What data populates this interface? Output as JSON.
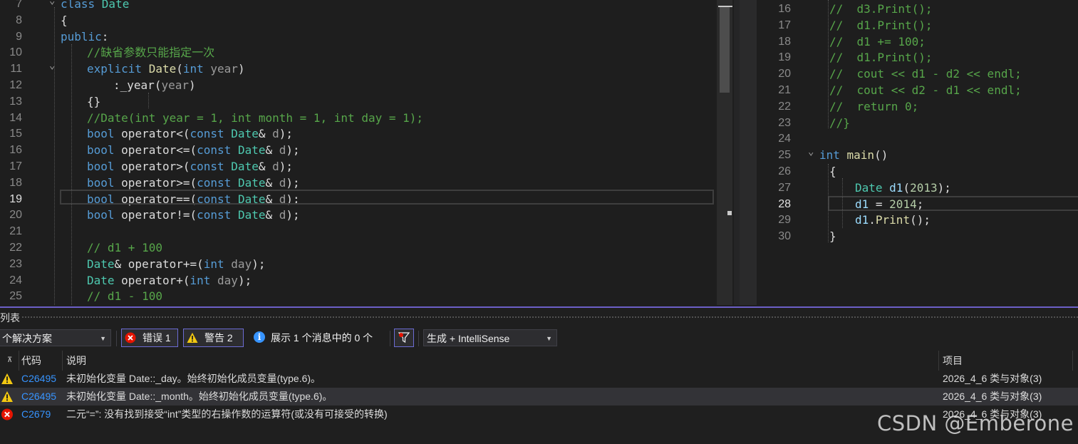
{
  "left_editor": {
    "lines": [
      {
        "n": "7",
        "fold": "⌄",
        "indent": 0,
        "tokens": [
          [
            "kw",
            "class "
          ],
          [
            "ty",
            "Date"
          ]
        ]
      },
      {
        "n": "8",
        "indent": 0,
        "tokens": [
          [
            "txt",
            "{"
          ]
        ]
      },
      {
        "n": "9",
        "indent": 0,
        "tokens": [
          [
            "kw",
            "public"
          ],
          [
            "txt",
            ":"
          ]
        ]
      },
      {
        "n": "10",
        "indent": 1,
        "tokens": [
          [
            "cm",
            "//缺省参数只能指定一次"
          ]
        ]
      },
      {
        "n": "11",
        "fold": "⌄",
        "indent": 1,
        "tokens": [
          [
            "kw",
            "explicit "
          ],
          [
            "fn",
            "Date"
          ],
          [
            "txt",
            "("
          ],
          [
            "kw",
            "int "
          ],
          [
            "dim",
            "year"
          ],
          [
            "txt",
            ")"
          ]
        ]
      },
      {
        "n": "12",
        "indent": 2,
        "tokens": [
          [
            "txt",
            ":"
          ],
          [
            "txt",
            "_year"
          ],
          [
            "txt",
            "("
          ],
          [
            "dim",
            "year"
          ],
          [
            "txt",
            ")"
          ]
        ]
      },
      {
        "n": "13",
        "indent": 1,
        "tokens": [
          [
            "txt",
            "{}"
          ]
        ]
      },
      {
        "n": "14",
        "indent": 1,
        "tokens": [
          [
            "cm",
            "//Date(int year = 1, int month = 1, int day = 1);"
          ]
        ]
      },
      {
        "n": "15",
        "indent": 1,
        "tokens": [
          [
            "kw",
            "bool "
          ],
          [
            "txt",
            "operator<("
          ],
          [
            "kw",
            "const "
          ],
          [
            "ty",
            "Date"
          ],
          [
            "txt",
            "& "
          ],
          [
            "dim",
            "d"
          ],
          [
            "txt",
            ");"
          ]
        ]
      },
      {
        "n": "16",
        "indent": 1,
        "tokens": [
          [
            "kw",
            "bool "
          ],
          [
            "txt",
            "operator<=("
          ],
          [
            "kw",
            "const "
          ],
          [
            "ty",
            "Date"
          ],
          [
            "txt",
            "& "
          ],
          [
            "dim",
            "d"
          ],
          [
            "txt",
            ");"
          ]
        ]
      },
      {
        "n": "17",
        "indent": 1,
        "tokens": [
          [
            "kw",
            "bool "
          ],
          [
            "txt",
            "operator>("
          ],
          [
            "kw",
            "const "
          ],
          [
            "ty",
            "Date"
          ],
          [
            "txt",
            "& "
          ],
          [
            "dim",
            "d"
          ],
          [
            "txt",
            ");"
          ]
        ]
      },
      {
        "n": "18",
        "indent": 1,
        "tokens": [
          [
            "kw",
            "bool "
          ],
          [
            "txt",
            "operator>=("
          ],
          [
            "kw",
            "const "
          ],
          [
            "ty",
            "Date"
          ],
          [
            "txt",
            "& "
          ],
          [
            "dim",
            "d"
          ],
          [
            "txt",
            ");"
          ]
        ]
      },
      {
        "n": "19",
        "active": true,
        "indent": 1,
        "tokens": [
          [
            "kw",
            "bool "
          ],
          [
            "txt",
            "operator==("
          ],
          [
            "kw",
            "const "
          ],
          [
            "ty",
            "Date"
          ],
          [
            "txt",
            "& "
          ],
          [
            "dim",
            "d"
          ],
          [
            "txt",
            ");"
          ]
        ]
      },
      {
        "n": "20",
        "indent": 1,
        "tokens": [
          [
            "kw",
            "bool "
          ],
          [
            "txt",
            "operator!=("
          ],
          [
            "kw",
            "const "
          ],
          [
            "ty",
            "Date"
          ],
          [
            "txt",
            "& "
          ],
          [
            "dim",
            "d"
          ],
          [
            "txt",
            ");"
          ]
        ]
      },
      {
        "n": "21",
        "indent": 1,
        "tokens": []
      },
      {
        "n": "22",
        "indent": 1,
        "tokens": [
          [
            "cm",
            "// d1 + 100"
          ]
        ]
      },
      {
        "n": "23",
        "indent": 1,
        "tokens": [
          [
            "ty",
            "Date"
          ],
          [
            "txt",
            "& operator+=("
          ],
          [
            "kw",
            "int "
          ],
          [
            "dim",
            "day"
          ],
          [
            "txt",
            ");"
          ]
        ]
      },
      {
        "n": "24",
        "indent": 1,
        "tokens": [
          [
            "ty",
            "Date "
          ],
          [
            "txt",
            "operator+("
          ],
          [
            "kw",
            "int "
          ],
          [
            "dim",
            "day"
          ],
          [
            "txt",
            ");"
          ]
        ]
      },
      {
        "n": "25",
        "indent": 1,
        "tokens": [
          [
            "cm",
            "// d1 - 100"
          ]
        ]
      }
    ]
  },
  "right_editor": {
    "lines": [
      {
        "n": "16",
        "indent": 0,
        "tokens": [
          [
            "cm",
            "//  d3.Print();"
          ]
        ]
      },
      {
        "n": "17",
        "indent": 0,
        "tokens": [
          [
            "cm",
            "//  d1.Print();"
          ]
        ]
      },
      {
        "n": "18",
        "indent": 0,
        "tokens": [
          [
            "cm",
            "//  d1 += 100;"
          ]
        ]
      },
      {
        "n": "19",
        "indent": 0,
        "tokens": [
          [
            "cm",
            "//  d1.Print();"
          ]
        ]
      },
      {
        "n": "20",
        "indent": 0,
        "tokens": [
          [
            "cm",
            "//  cout << d1 - d2 << endl;"
          ]
        ]
      },
      {
        "n": "21",
        "indent": 0,
        "tokens": [
          [
            "cm",
            "//  cout << d2 - d1 << endl;"
          ]
        ]
      },
      {
        "n": "22",
        "indent": 0,
        "tokens": [
          [
            "cm",
            "//  return 0;"
          ]
        ]
      },
      {
        "n": "23",
        "indent": 0,
        "tokens": [
          [
            "cm",
            "//}"
          ]
        ]
      },
      {
        "n": "24",
        "indent": 0,
        "tokens": []
      },
      {
        "n": "25",
        "fold": "⌄",
        "indent": -1,
        "tokens": [
          [
            "kw",
            "int "
          ],
          [
            "fn",
            "main"
          ],
          [
            "txt",
            "()"
          ]
        ]
      },
      {
        "n": "26",
        "indent": 0,
        "tokens": [
          [
            "txt",
            "{"
          ]
        ]
      },
      {
        "n": "27",
        "indent": 1,
        "tokens": [
          [
            "ty",
            "Date "
          ],
          [
            "var",
            "d1"
          ],
          [
            "txt",
            "("
          ],
          [
            "num",
            "2013"
          ],
          [
            "txt",
            ");"
          ]
        ]
      },
      {
        "n": "28",
        "active": true,
        "indent": 1,
        "tokens": [
          [
            "var",
            "d1"
          ],
          [
            "txt",
            " = "
          ],
          [
            "num",
            "2014"
          ],
          [
            "txt",
            ";"
          ]
        ]
      },
      {
        "n": "29",
        "indent": 1,
        "tokens": [
          [
            "var",
            "d1"
          ],
          [
            "txt",
            "."
          ],
          [
            "fn",
            "Print"
          ],
          [
            "txt",
            "();"
          ]
        ]
      },
      {
        "n": "30",
        "indent": 0,
        "tokens": [
          [
            "txt",
            "}"
          ]
        ]
      }
    ]
  },
  "error_list": {
    "title": "列表",
    "scope_value": "个解决方案",
    "errors_label": "错误 1",
    "warnings_label": "警告 2",
    "messages_label": "展示 1 个消息中的 0 个",
    "build_filter_value": "生成 + IntelliSense",
    "columns": {
      "code": "代码",
      "description": "说明",
      "project": "项目"
    },
    "rows": [
      {
        "severity": "warning",
        "code": "C26495",
        "description": "未初始化变量 Date::_day。始终初始化成员变量(type.6)。",
        "project": "2026_4_6 类与对象(3)",
        "selected": false
      },
      {
        "severity": "warning",
        "code": "C26495",
        "description": "未初始化变量 Date::_month。始终初始化成员变量(type.6)。",
        "project": "2026_4_6 类与对象(3)",
        "selected": true
      },
      {
        "severity": "error",
        "code": "C2679",
        "description": "二元“=”: 没有找到接受“int”类型的右操作数的运算符(或没有可接受的转换)",
        "project": "2026_4_6 类与对象(3)",
        "selected": false
      }
    ]
  },
  "watermark": "CSDN @Emberone",
  "colors": {
    "accent": "#6c5fc7",
    "link": "#3794ff",
    "warning": "#f2c811",
    "error": "#e51400"
  }
}
